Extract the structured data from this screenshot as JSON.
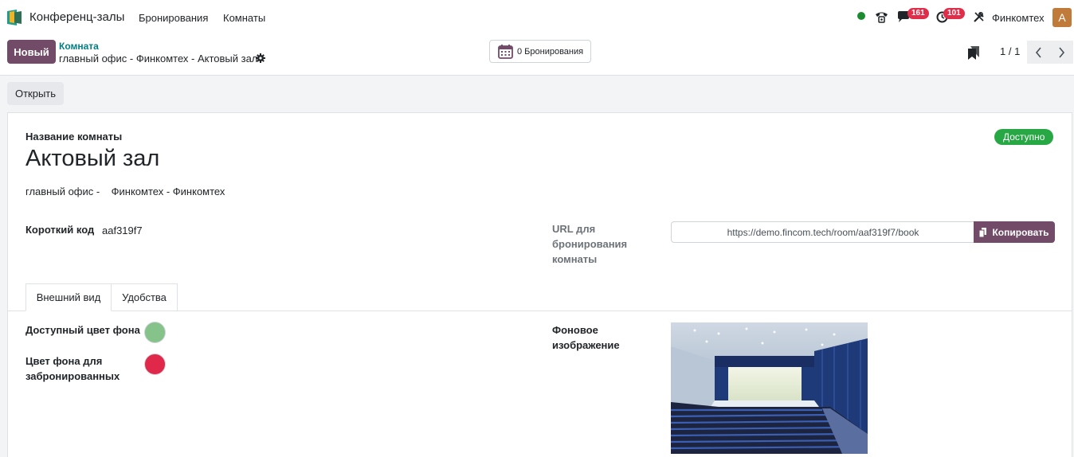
{
  "navbar": {
    "app_name": "Конференц-залы",
    "menu": [
      "Бронирования",
      "Комнаты"
    ],
    "chat_badge": "161",
    "activity_badge": "101",
    "company": "Финкомтех",
    "avatar_letter": "A"
  },
  "control": {
    "new_label": "Новый",
    "breadcrumb_parent": "Комната",
    "breadcrumb_current": "главный офис - Финкомтех - Актовый зал",
    "bookings_label": "0 Бронирования",
    "pager": "1 / 1"
  },
  "actions": {
    "open_label": "Открыть"
  },
  "form": {
    "room_name_label": "Название комнаты",
    "room_name": "Актовый зал",
    "location": "главный офис -    Финкомтех - Финкомтех",
    "status": "Доступно",
    "short_code_label": "Короткий код",
    "short_code": "aaf319f7",
    "url_label_1": "URL для",
    "url_label_2": "бронирования",
    "url_label_3": "комнаты",
    "url": "https://demo.fincom.tech/room/aaf319f7/book",
    "copy_label": "Копировать"
  },
  "tabs": [
    "Внешний вид",
    "Удобства"
  ],
  "appearance": {
    "available_color_label": "Доступный цвет фона",
    "booked_color_label_1": "Цвет фона для",
    "booked_color_label_2": "забронированных",
    "bg_image_label_1": "Фоновое",
    "bg_image_label_2": "изображение",
    "available_color": "#86c38a",
    "booked_color": "#e0284a"
  },
  "colors": {
    "brand": "#714b67",
    "link": "#017e84",
    "success": "#28a745",
    "danger": "#e02d4a"
  }
}
